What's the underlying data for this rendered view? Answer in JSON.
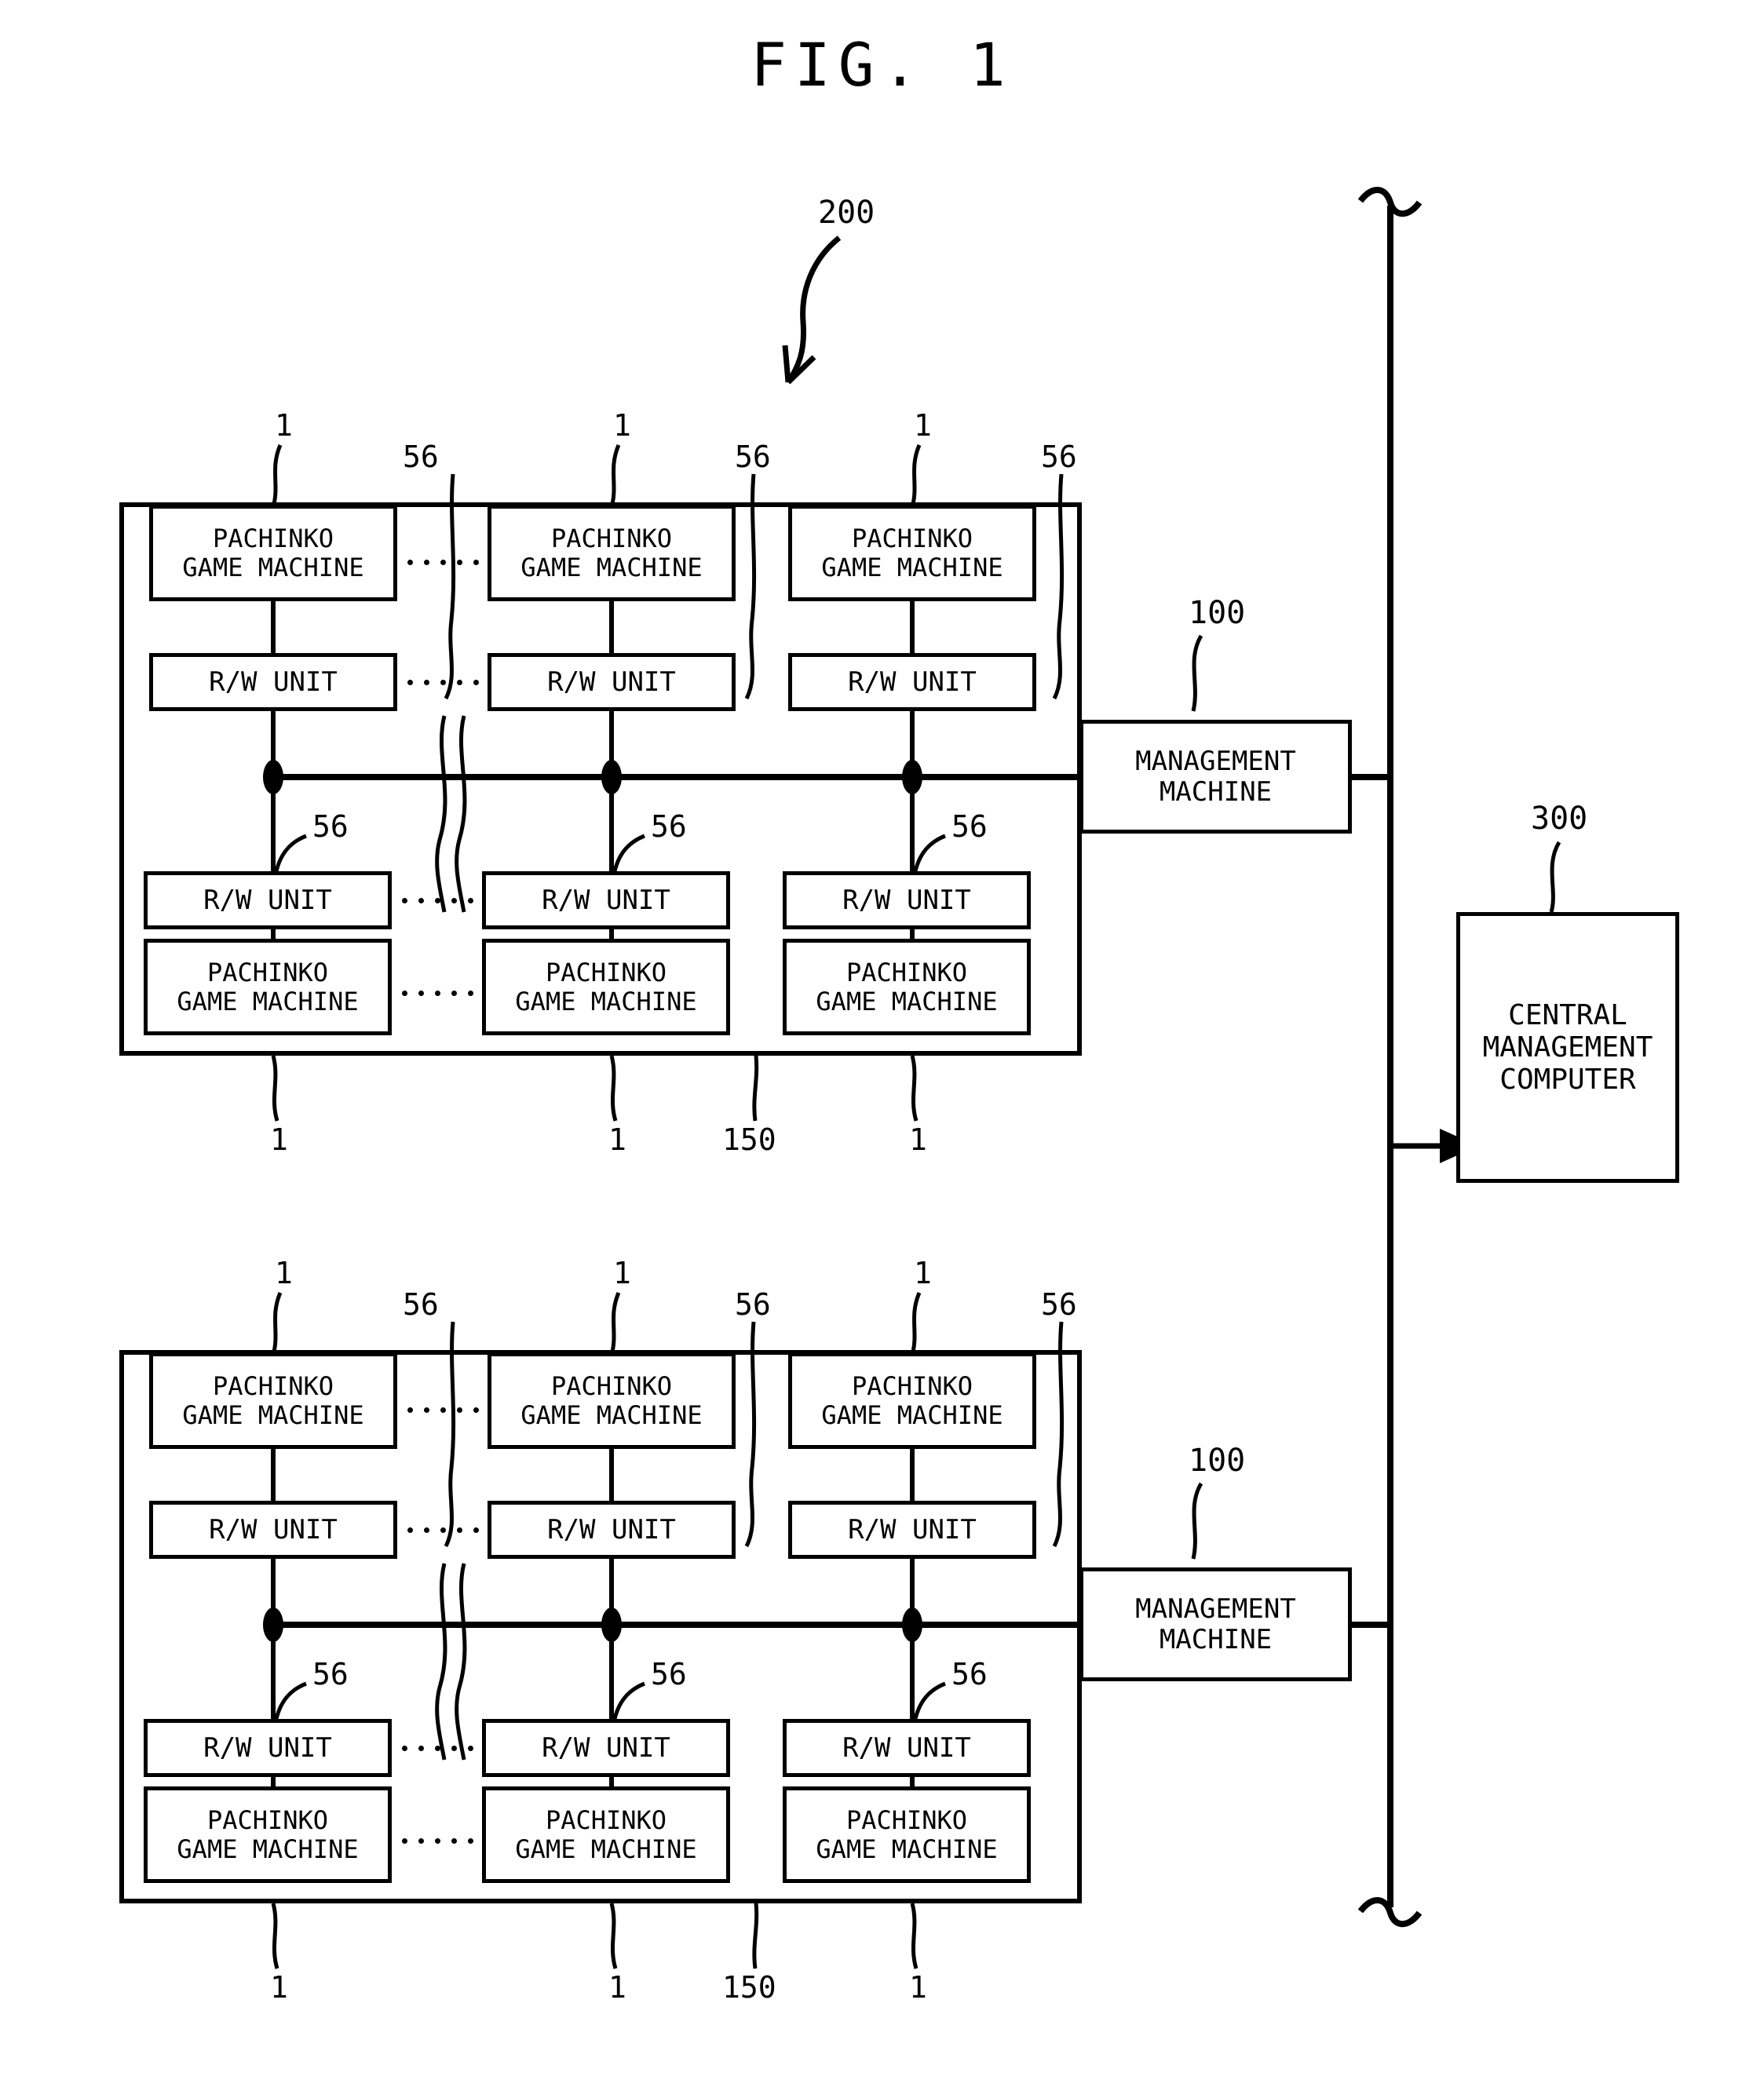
{
  "figure": {
    "title": "FIG. 1",
    "system_ref": "200",
    "central_ref": "300"
  },
  "labels": {
    "pachinko_game_machine": "PACHINKO\nGAME MACHINE",
    "rw_unit": "R/W UNIT",
    "management_machine": "MANAGEMENT\nMACHINE",
    "central_management_computer": "CENTRAL\nMANAGEMENT\nCOMPUTER"
  },
  "refs": {
    "machine": "1",
    "rw_link": "56",
    "hall_bus": "150",
    "management": "100",
    "system": "200",
    "central": "300"
  },
  "blocks": [
    {
      "name": "upper-hall",
      "hall_ref": "150",
      "management_ref": "100",
      "columns": [
        {
          "top_machine_ref": "1",
          "top_rw_ref": "56",
          "bottom_rw_ref": "56",
          "bottom_machine_ref": "1",
          "top_machine": "PACHINKO\nGAME MACHINE",
          "top_rw": "R/W UNIT",
          "bottom_rw": "R/W UNIT",
          "bottom_machine": "PACHINKO\nGAME MACHINE"
        },
        {
          "top_machine_ref": "1",
          "top_rw_ref": "56",
          "bottom_rw_ref": "56",
          "bottom_machine_ref": "1",
          "top_machine": "PACHINKO\nGAME MACHINE",
          "top_rw": "R/W UNIT",
          "bottom_rw": "R/W UNIT",
          "bottom_machine": "PACHINKO\nGAME MACHINE"
        },
        {
          "top_machine_ref": "1",
          "top_rw_ref": "56",
          "bottom_rw_ref": "56",
          "bottom_machine_ref": "1",
          "top_machine": "PACHINKO\nGAME MACHINE",
          "top_rw": "R/W UNIT",
          "bottom_rw": "R/W UNIT",
          "bottom_machine": "PACHINKO\nGAME MACHINE"
        }
      ],
      "management_machine": "MANAGEMENT\nMACHINE"
    },
    {
      "name": "lower-hall",
      "hall_ref": "150",
      "management_ref": "100",
      "columns": [
        {
          "top_machine_ref": "1",
          "top_rw_ref": "56",
          "bottom_rw_ref": "56",
          "bottom_machine_ref": "1",
          "top_machine": "PACHINKO\nGAME MACHINE",
          "top_rw": "R/W UNIT",
          "bottom_rw": "R/W UNIT",
          "bottom_machine": "PACHINKO\nGAME MACHINE"
        },
        {
          "top_machine_ref": "1",
          "top_rw_ref": "56",
          "bottom_rw_ref": "56",
          "bottom_machine_ref": "1",
          "top_machine": "PACHINKO\nGAME MACHINE",
          "top_rw": "R/W UNIT",
          "bottom_rw": "R/W UNIT",
          "bottom_machine": "PACHINKO\nGAME MACHINE"
        },
        {
          "top_machine_ref": "1",
          "top_rw_ref": "56",
          "bottom_rw_ref": "56",
          "bottom_machine_ref": "1",
          "top_machine": "PACHINKO\nGAME MACHINE",
          "top_rw": "R/W UNIT",
          "bottom_rw": "R/W UNIT",
          "bottom_machine": "PACHINKO\nGAME MACHINE"
        }
      ],
      "management_machine": "MANAGEMENT\nMACHINE"
    }
  ],
  "central": {
    "label": "CENTRAL\nMANAGEMENT\nCOMPUTER",
    "ref": "300"
  },
  "colors": {
    "ink": "#000000",
    "paper": "#ffffff"
  }
}
